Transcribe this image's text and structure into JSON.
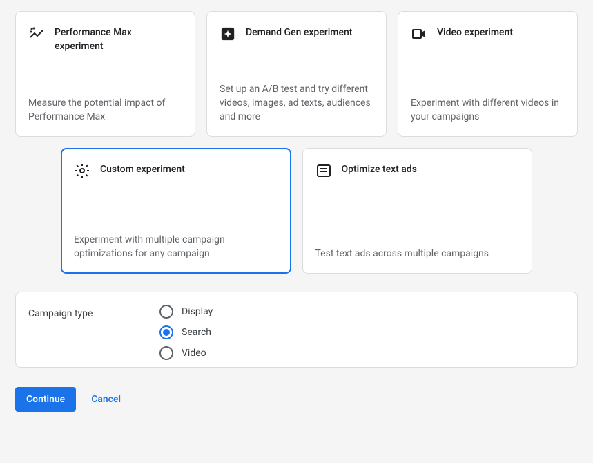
{
  "cards": {
    "pmax": {
      "title": "Performance Max experiment",
      "desc": "Measure the potential impact of Performance Max"
    },
    "demandgen": {
      "title": "Demand Gen experiment",
      "desc": "Set up an A/B test and try different videos, images, ad texts, audiences and more"
    },
    "video": {
      "title": "Video experiment",
      "desc": "Experiment with different videos in your campaigns"
    },
    "custom": {
      "title": "Custom experiment",
      "desc": "Experiment with multiple campaign optimizations for any campaign"
    },
    "optimize": {
      "title": "Optimize text ads",
      "desc": "Test text ads across multiple campaigns"
    }
  },
  "campaign_type": {
    "label": "Campaign type",
    "options": {
      "display": "Display",
      "search": "Search",
      "video": "Video"
    },
    "selected": "search"
  },
  "actions": {
    "continue": "Continue",
    "cancel": "Cancel"
  }
}
